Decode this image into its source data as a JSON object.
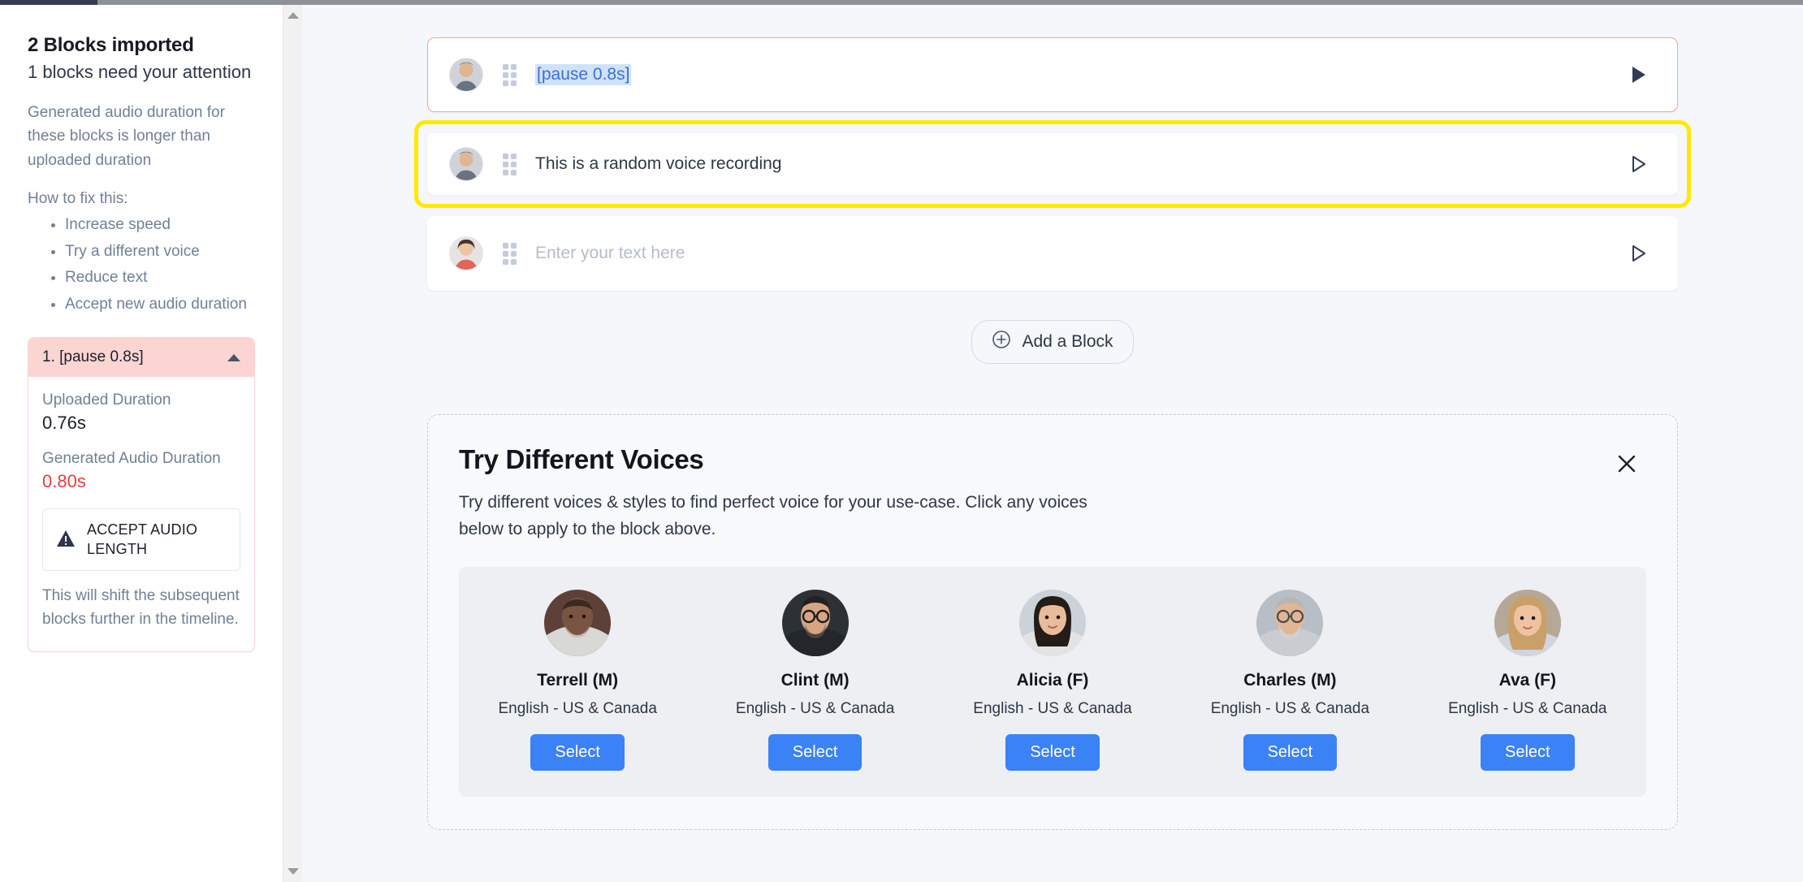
{
  "top_progress": {
    "percent": 5
  },
  "sidebar": {
    "title": "2 Blocks imported",
    "subtitle": "1 blocks need your attention",
    "description": "Generated audio duration for these blocks is longer than uploaded duration",
    "how_to_fix_label": "How to fix this:",
    "fix_items": [
      "Increase speed",
      "Try a different voice",
      "Reduce text",
      "Accept new audio duration"
    ],
    "issue_card": {
      "header": "1. [pause 0.8s]",
      "uploaded_duration_label": "Uploaded Duration",
      "uploaded_duration_value": "0.76s",
      "generated_duration_label": "Generated Audio Duration",
      "generated_duration_value": "0.80s",
      "accept_button_label": "ACCEPT AUDIO LENGTH",
      "note": "This will shift the subsequent blocks further in the timeline."
    }
  },
  "main": {
    "blocks": [
      {
        "text": "[pause 0.8s]",
        "state": "error",
        "selected": true,
        "playing": true
      },
      {
        "text": "This is a random voice recording",
        "state": "highlighted",
        "selected": false,
        "playing": false
      },
      {
        "text": "",
        "placeholder": "Enter your text here",
        "state": "empty",
        "selected": false,
        "playing": false
      }
    ],
    "add_block_label": "Add a Block"
  },
  "voices_panel": {
    "title": "Try Different Voices",
    "description": "Try different voices & styles to find perfect voice for your use-case. Click any voices below to apply to the block above.",
    "select_label": "Select",
    "voices": [
      {
        "name": "Terrell (M)",
        "language": "English - US & Canada",
        "skin": "#7a5442",
        "hair": "#3a2a22",
        "shirt": "#d8d8d4",
        "bg": "#5d4038",
        "glasses": false,
        "beard": true
      },
      {
        "name": "Clint (M)",
        "language": "English - US & Canada",
        "skin": "#d8a583",
        "hair": "#24201d",
        "shirt": "#23272c",
        "bg": "#2c3136",
        "glasses": true,
        "beard": true
      },
      {
        "name": "Alicia (F)",
        "language": "English - US & Canada",
        "skin": "#e8bb9a",
        "hair": "#241c18",
        "shirt": "#e3e3e3",
        "bg": "#cbd2da",
        "glasses": false,
        "beard": false
      },
      {
        "name": "Charles (M)",
        "language": "English - US & Canada",
        "skin": "#e2b695",
        "hair": "#b9b6b2",
        "shirt": "#c9cdd2",
        "bg": "#b8bec6",
        "glasses": true,
        "beard": true
      },
      {
        "name": "Ava (F)",
        "language": "English - US & Canada",
        "skin": "#eec3a1",
        "hair": "#caa06a",
        "shirt": "#cfd6de",
        "bg": "#b6a896",
        "glasses": false,
        "beard": false
      }
    ]
  },
  "colors": {
    "accent_blue": "#3b82f6",
    "highlight_yellow": "#ffe900",
    "error_red": "#e53e3e",
    "error_border": "#f2a6a0",
    "error_header_bg": "#fbd5d1",
    "selection_blue": "#cfe2fb",
    "navy": "#343b54"
  }
}
